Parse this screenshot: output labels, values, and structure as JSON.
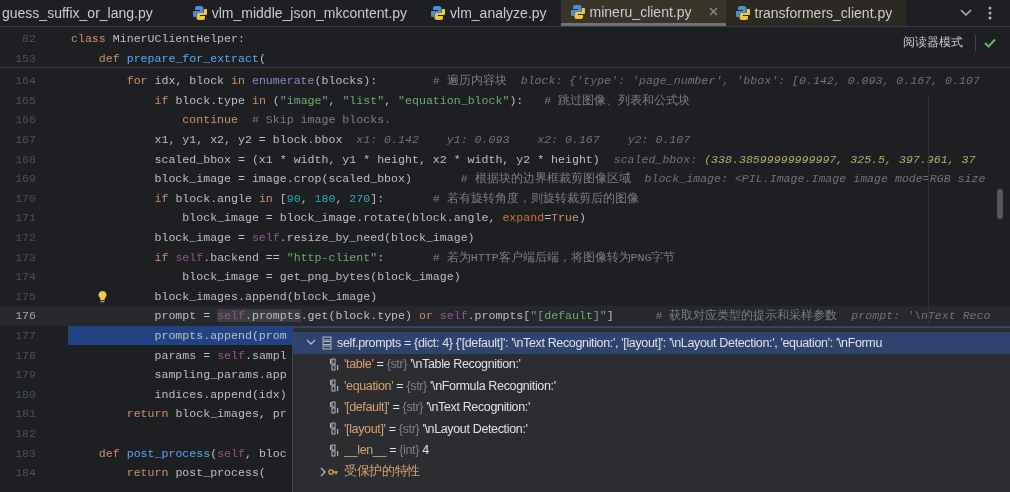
{
  "tabs": [
    {
      "label": "guess_suffix_or_lang.py",
      "selected": false,
      "has_icon": false
    },
    {
      "label": "vlm_middle_json_mkcontent.py",
      "selected": false,
      "has_icon": true
    },
    {
      "label": "vlm_analyze.py",
      "selected": false,
      "has_icon": true
    },
    {
      "label": "mineru_client.py",
      "selected": true,
      "has_icon": true
    },
    {
      "label": "transformers_client.py",
      "selected": false,
      "has_icon": true
    }
  ],
  "reader_mode": {
    "label": "阅读器模式"
  },
  "sticky_lines": [
    {
      "number": "82",
      "tokens": [
        {
          "kind": "kw",
          "text": "class"
        },
        {
          "kind": "plain",
          "text": " MinerUClientHelper:"
        }
      ]
    },
    {
      "number": "153",
      "tokens": [
        {
          "kind": "kw",
          "text": "    def "
        },
        {
          "kind": "fn",
          "text": "prepare_for_extract"
        },
        {
          "kind": "plain",
          "text": "("
        }
      ]
    }
  ],
  "lines": [
    {
      "number": "164",
      "current": false,
      "selected": false,
      "bulb": false,
      "tokens": [
        {
          "kind": "kw",
          "text": "        for"
        },
        {
          "kind": "plain",
          "text": " idx, block "
        },
        {
          "kind": "kw",
          "text": "in "
        },
        {
          "kind": "builtin",
          "text": "enumerate"
        },
        {
          "kind": "plain",
          "text": "(blocks):        "
        },
        {
          "kind": "com",
          "text": "# 遍历内容块  "
        },
        {
          "kind": "hint",
          "text": "block: {'type': 'page_number', 'bbox': [0.142, 0.093, 0.167, 0.107"
        }
      ]
    },
    {
      "number": "165",
      "current": false,
      "selected": false,
      "bulb": false,
      "tokens": [
        {
          "kind": "kw",
          "text": "            if"
        },
        {
          "kind": "plain",
          "text": " block.type "
        },
        {
          "kind": "kw",
          "text": "in"
        },
        {
          "kind": "plain",
          "text": " ("
        },
        {
          "kind": "str",
          "text": "\"image\""
        },
        {
          "kind": "plain",
          "text": ", "
        },
        {
          "kind": "str",
          "text": "\"list\""
        },
        {
          "kind": "plain",
          "text": ", "
        },
        {
          "kind": "str",
          "text": "\"equation_block\""
        },
        {
          "kind": "plain",
          "text": "):   "
        },
        {
          "kind": "com",
          "text": "# 跳过图像、列表和公式块"
        }
      ]
    },
    {
      "number": "166",
      "current": false,
      "selected": false,
      "bulb": false,
      "tokens": [
        {
          "kind": "kw",
          "text": "                continue  "
        },
        {
          "kind": "com",
          "text": "# Skip image blocks."
        }
      ]
    },
    {
      "number": "167",
      "current": false,
      "selected": false,
      "bulb": false,
      "tokens": [
        {
          "kind": "plain",
          "text": "            x1, y1, x2, y2 = block.bbox  "
        },
        {
          "kind": "hint",
          "text": "x1: 0.142    "
        },
        {
          "kind": "hint",
          "text": "y1: 0.093    "
        },
        {
          "kind": "hint",
          "text": "x2: 0.167    "
        },
        {
          "kind": "hint",
          "text": "y2: 0.107"
        }
      ]
    },
    {
      "number": "168",
      "current": false,
      "selected": false,
      "bulb": false,
      "tokens": [
        {
          "kind": "plain",
          "text": "            scaled_bbox = (x1 * width, y1 * height, x2 * width, y2 * height)  "
        },
        {
          "kind": "hint",
          "text": "scaled_bbox: "
        },
        {
          "kind": "hintval",
          "text": "(338.38599999999997, 325.5, 397.961, 37"
        }
      ]
    },
    {
      "number": "169",
      "current": false,
      "selected": false,
      "bulb": false,
      "tokens": [
        {
          "kind": "plain",
          "text": "            block_image = image.crop(scaled_bbox)       "
        },
        {
          "kind": "com",
          "text": "# 根据块的边界框裁剪图像区域  "
        },
        {
          "kind": "hint",
          "text": "block_image: <PIL.Image.Image image mode=RGB size"
        }
      ]
    },
    {
      "number": "170",
      "current": false,
      "selected": false,
      "bulb": false,
      "tokens": [
        {
          "kind": "kw",
          "text": "            if"
        },
        {
          "kind": "plain",
          "text": " block.angle "
        },
        {
          "kind": "kw",
          "text": "in"
        },
        {
          "kind": "plain",
          "text": " ["
        },
        {
          "kind": "num",
          "text": "90"
        },
        {
          "kind": "plain",
          "text": ", "
        },
        {
          "kind": "num",
          "text": "180"
        },
        {
          "kind": "plain",
          "text": ", "
        },
        {
          "kind": "num",
          "text": "270"
        },
        {
          "kind": "plain",
          "text": "]:       "
        },
        {
          "kind": "com",
          "text": "# 若有旋转角度，则旋转裁剪后的图像"
        }
      ]
    },
    {
      "number": "171",
      "current": false,
      "selected": false,
      "bulb": false,
      "tokens": [
        {
          "kind": "plain",
          "text": "                block_image = block_image.rotate(block.angle, "
        },
        {
          "kind": "param",
          "text": "expand"
        },
        {
          "kind": "plain",
          "text": "="
        },
        {
          "kind": "kw",
          "text": "True"
        },
        {
          "kind": "plain",
          "text": ")"
        }
      ]
    },
    {
      "number": "172",
      "current": false,
      "selected": false,
      "bulb": false,
      "tokens": [
        {
          "kind": "plain",
          "text": "            block_image = "
        },
        {
          "kind": "self",
          "text": "self"
        },
        {
          "kind": "plain",
          "text": ".resize_by_need(block_image)"
        }
      ]
    },
    {
      "number": "173",
      "current": false,
      "selected": false,
      "bulb": false,
      "tokens": [
        {
          "kind": "kw",
          "text": "            if "
        },
        {
          "kind": "self",
          "text": "self"
        },
        {
          "kind": "plain",
          "text": ".backend == "
        },
        {
          "kind": "str",
          "text": "\"http-client\""
        },
        {
          "kind": "plain",
          "text": ":       "
        },
        {
          "kind": "com",
          "text": "# 若为HTTP客户端后端，将图像转为PNG字节"
        }
      ]
    },
    {
      "number": "174",
      "current": false,
      "selected": false,
      "bulb": false,
      "tokens": [
        {
          "kind": "plain",
          "text": "                block_image = get_png_bytes(block_image)"
        }
      ]
    },
    {
      "number": "175",
      "current": false,
      "selected": false,
      "bulb": true,
      "tokens": [
        {
          "kind": "plain",
          "text": "            block_images.append(block_image)"
        }
      ]
    },
    {
      "number": "176",
      "current": true,
      "selected": false,
      "bulb": false,
      "tokens": [
        {
          "kind": "plain",
          "text": "            prompt = "
        },
        {
          "kind": "selfmark",
          "text": "self"
        },
        {
          "kind": "plainmark",
          "text": ".prompts"
        },
        {
          "kind": "plain",
          "text": ".get(block.type) "
        },
        {
          "kind": "kw",
          "text": "or "
        },
        {
          "kind": "self",
          "text": "self"
        },
        {
          "kind": "plain",
          "text": ".prompts["
        },
        {
          "kind": "str",
          "text": "\"[default]\""
        },
        {
          "kind": "plain",
          "text": "]      "
        },
        {
          "kind": "com",
          "text": "# 获取对应类型的提示和采样参数  "
        },
        {
          "kind": "hint",
          "text": "prompt: '\\nText Reco"
        }
      ]
    },
    {
      "number": "177",
      "current": false,
      "selected": true,
      "bulb": false,
      "tokens": [
        {
          "kind": "plain",
          "text": "            prompts.append(prom"
        }
      ]
    },
    {
      "number": "178",
      "current": false,
      "selected": false,
      "bulb": false,
      "tokens": [
        {
          "kind": "plain",
          "text": "            params = "
        },
        {
          "kind": "self",
          "text": "self"
        },
        {
          "kind": "plain",
          "text": ".sampl"
        }
      ]
    },
    {
      "number": "179",
      "current": false,
      "selected": false,
      "bulb": false,
      "tokens": [
        {
          "kind": "plain",
          "text": "            sampling_params.app"
        }
      ]
    },
    {
      "number": "180",
      "current": false,
      "selected": false,
      "bulb": false,
      "tokens": [
        {
          "kind": "plain",
          "text": "            indices.append(idx)"
        }
      ]
    },
    {
      "number": "181",
      "current": false,
      "selected": false,
      "bulb": false,
      "tokens": [
        {
          "kind": "kw",
          "text": "        return"
        },
        {
          "kind": "plain",
          "text": " block_images, pr"
        }
      ]
    },
    {
      "number": "182",
      "current": false,
      "selected": false,
      "bulb": false
    },
    {
      "number": "183",
      "current": false,
      "selected": false,
      "bulb": false,
      "tokens": [
        {
          "kind": "kw",
          "text": "    def "
        },
        {
          "kind": "fn",
          "text": "post_process"
        },
        {
          "kind": "plain",
          "text": "("
        },
        {
          "kind": "self",
          "text": "self"
        },
        {
          "kind": "plain",
          "text": ", bloc"
        }
      ]
    },
    {
      "number": "184",
      "current": false,
      "selected": false,
      "bulb": false,
      "tokens": [
        {
          "kind": "kw",
          "text": "        return"
        },
        {
          "kind": "plain",
          "text": " post_process("
        }
      ]
    }
  ],
  "debug_popup": {
    "rows": [
      {
        "kind": "dict",
        "name": "self.prompts",
        "operator": "=",
        "type": "{dict: 4}",
        "value": "{'[default]': '\\nText Recognition:', '[layout]': '\\nLayout Detection:', 'equation': '\\nFormu",
        "expanded": true,
        "selected": true,
        "children": [
          {
            "kind": "str",
            "name": "'table'",
            "operator": "=",
            "type": "{str}",
            "value": "'\\nTable Recognition:'",
            "selected": false
          },
          {
            "kind": "str",
            "name": "'equation'",
            "operator": "=",
            "type": "{str}",
            "value": "'\\nFormula Recognition:'",
            "selected": false
          },
          {
            "kind": "str",
            "name": "'[default]'",
            "operator": "=",
            "type": "{str}",
            "value": "'\\nText Recognition:'",
            "selected": false
          },
          {
            "kind": "str",
            "name": "'[layout]'",
            "operator": "=",
            "type": "{str}",
            "value": "'\\nLayout Detection:'",
            "selected": false
          },
          {
            "kind": "int",
            "name": "__len__",
            "operator": "=",
            "type": "{int}",
            "value": "4",
            "selected": false
          },
          {
            "kind": "group",
            "name": "受保护的特性",
            "expanded": false,
            "selected": false
          }
        ]
      }
    ]
  }
}
